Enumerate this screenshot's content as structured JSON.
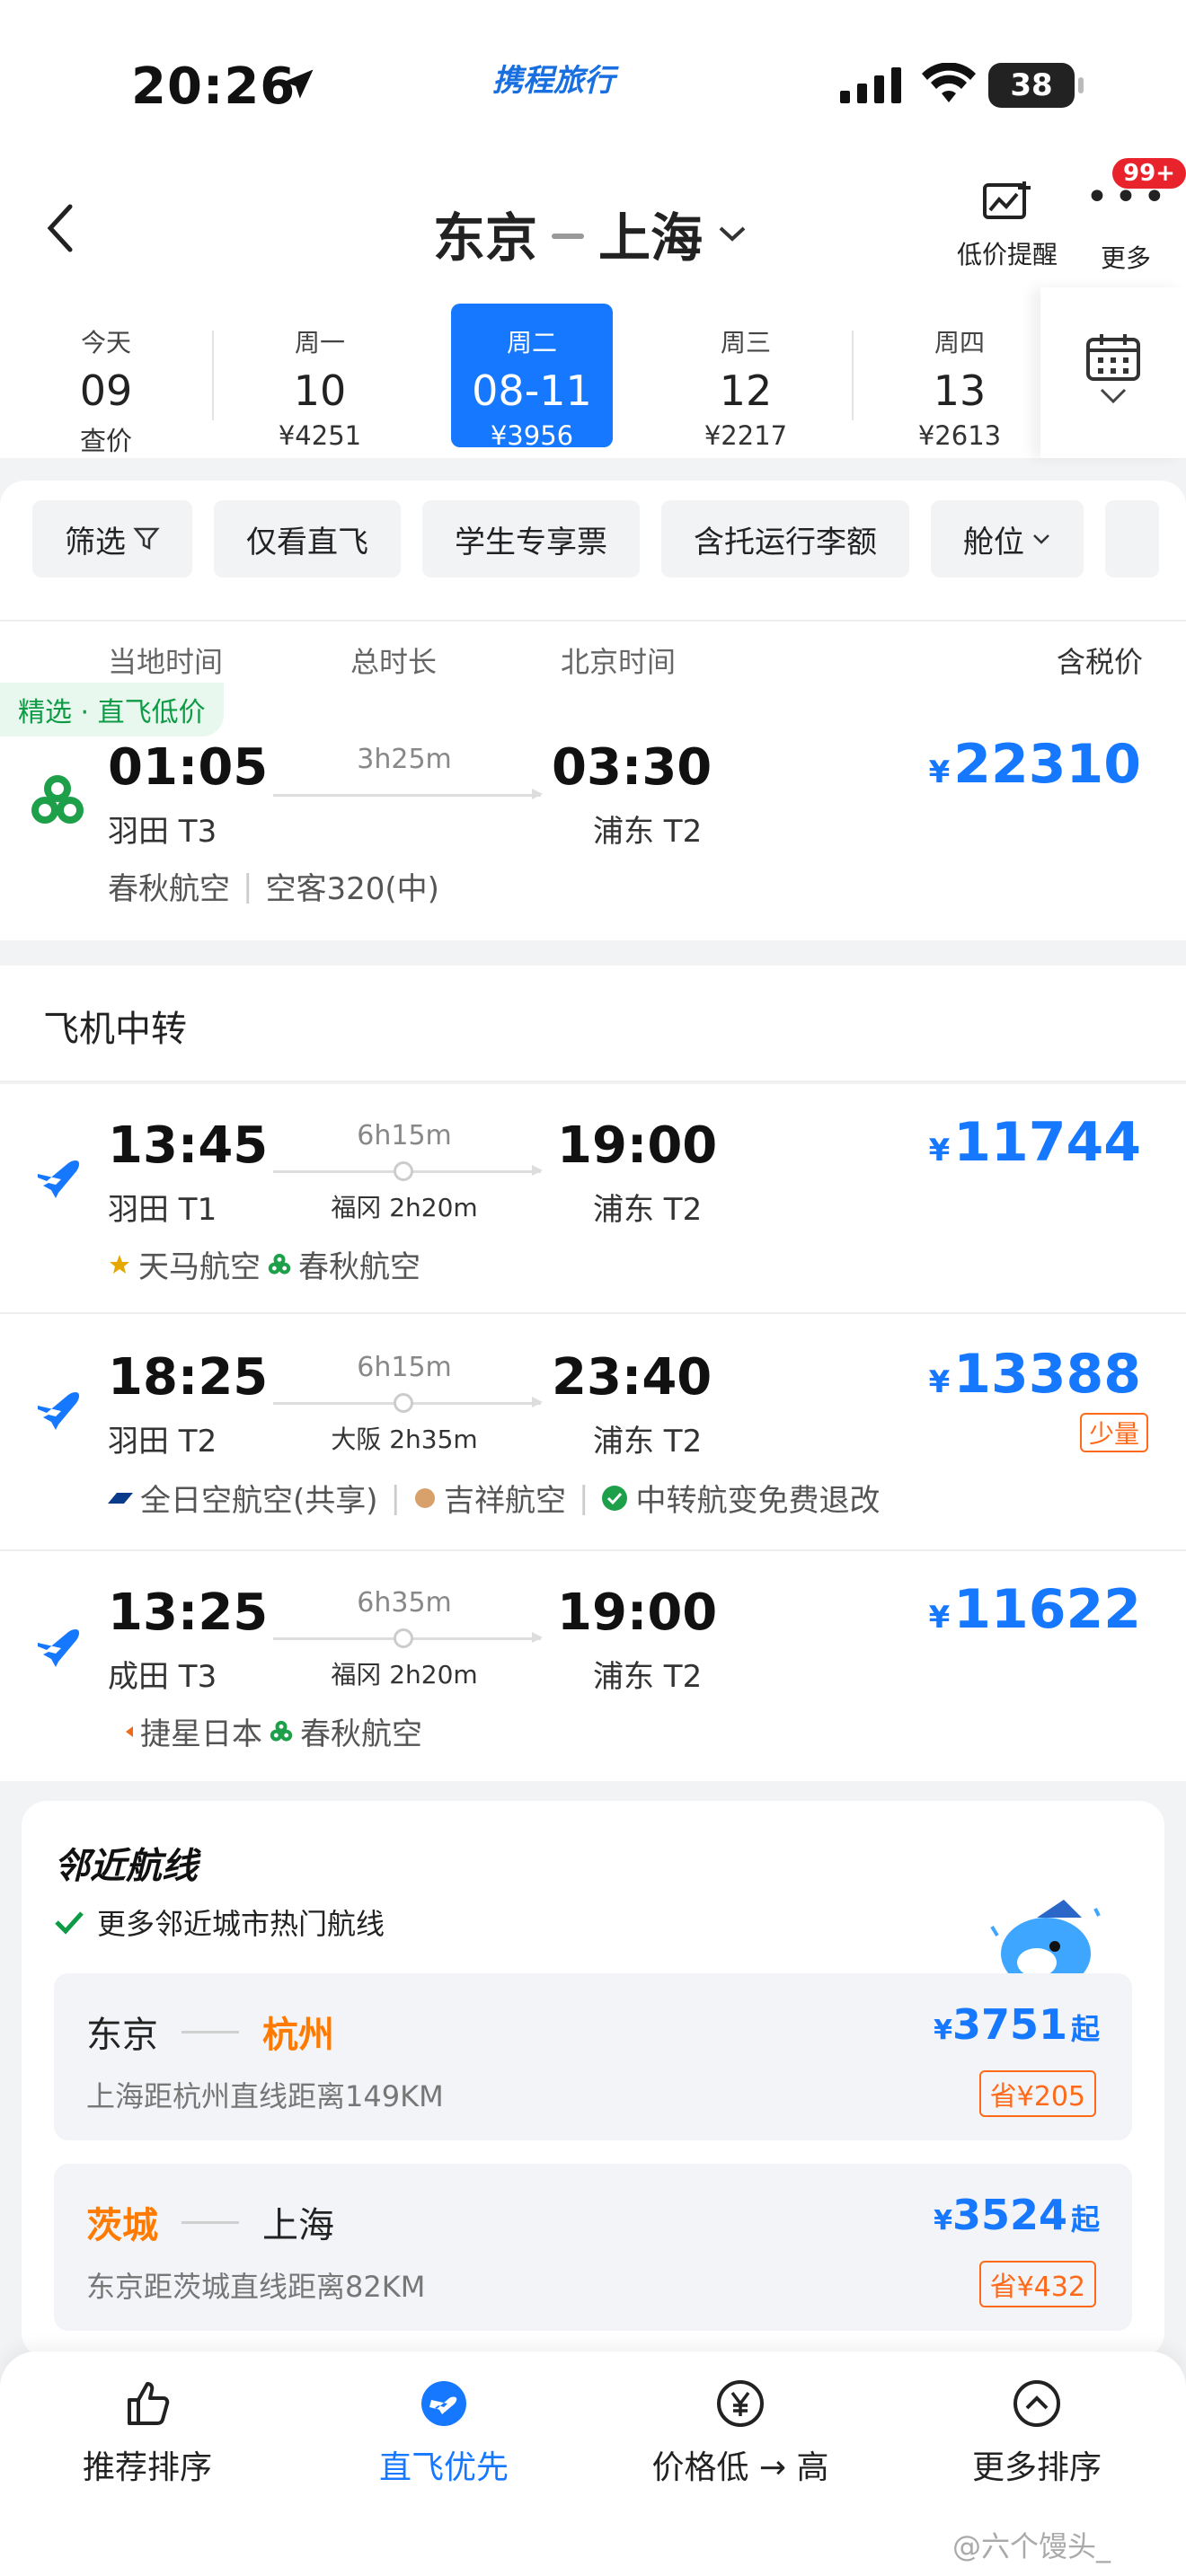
{
  "status": {
    "time": "20:26",
    "brand": "携程旅行",
    "battery": "38"
  },
  "header": {
    "from": "东京",
    "to": "上海",
    "alert_label": "低价提醒",
    "more_label": "更多",
    "badge": "99+"
  },
  "dates": [
    {
      "weekday": "今天",
      "day": "09",
      "price": "查价"
    },
    {
      "weekday": "周一",
      "day": "10",
      "price": "¥4251"
    },
    {
      "weekday": "周二",
      "day": "08-11",
      "price": "¥3956",
      "selected": true
    },
    {
      "weekday": "周三",
      "day": "12",
      "price": "¥2217"
    },
    {
      "weekday": "周四",
      "day": "13",
      "price": "¥2613"
    }
  ],
  "filters": [
    "筛选",
    "仅看直飞",
    "学生专享票",
    "含托运行李额",
    "舱位"
  ],
  "columns": {
    "local": "当地时间",
    "duration": "总时长",
    "beijing": "北京时间",
    "tax": "含税价"
  },
  "direct": {
    "tag": "精选 · 直飞低价",
    "dep": "01:05",
    "dep_term": "羽田 T3",
    "duration": "3h25m",
    "arr": "03:30",
    "arr_term": "浦东 T2",
    "currency": "¥",
    "price": "22310",
    "airline": "春秋航空",
    "aircraft": "空客320(中)"
  },
  "transfer_title": "飞机中转",
  "transfers": [
    {
      "dep": "13:45",
      "dep_term": "羽田 T1",
      "duration": "6h15m",
      "via": "福冈 2h20m",
      "arr": "19:00",
      "arr_term": "浦东 T2",
      "price": "11744",
      "airlines": [
        "天马航空",
        "春秋航空"
      ],
      "extra": ""
    },
    {
      "dep": "18:25",
      "dep_term": "羽田 T2",
      "duration": "6h15m",
      "via": "大阪 2h35m",
      "arr": "23:40",
      "arr_term": "浦东 T2",
      "price": "13388",
      "few": "少量",
      "airlines": [
        "全日空航空(共享)",
        "吉祥航空"
      ],
      "extra": "中转航变免费退改"
    },
    {
      "dep": "13:25",
      "dep_term": "成田 T3",
      "duration": "6h35m",
      "via": "福冈 2h20m",
      "arr": "19:00",
      "arr_term": "浦东 T2",
      "price": "11622",
      "airlines": [
        "捷星日本",
        "春秋航空"
      ],
      "extra": ""
    }
  ],
  "nearby": {
    "title": "邻近航线",
    "subtitle": "更多邻近城市热门航线",
    "routes": [
      {
        "from": "东京",
        "to": "杭州",
        "highlight": "to",
        "dist": "上海距杭州直线距离149KM",
        "price": "3751",
        "qi": "起",
        "save": "省¥205"
      },
      {
        "from": "茨城",
        "to": "上海",
        "highlight": "from",
        "dist": "东京距茨城直线距离82KM",
        "price": "3524",
        "qi": "起",
        "save": "省¥432"
      }
    ]
  },
  "tabs": [
    {
      "label": "推荐排序",
      "active": false
    },
    {
      "label": "直飞优先",
      "active": true
    },
    {
      "label": "价格低 → 高",
      "active": false
    },
    {
      "label": "更多排序",
      "active": false
    }
  ],
  "watermark": "@六个馒头_",
  "colors": {
    "accent": "#1677ff",
    "orange": "#ff7a00",
    "green": "#0d9b45"
  }
}
